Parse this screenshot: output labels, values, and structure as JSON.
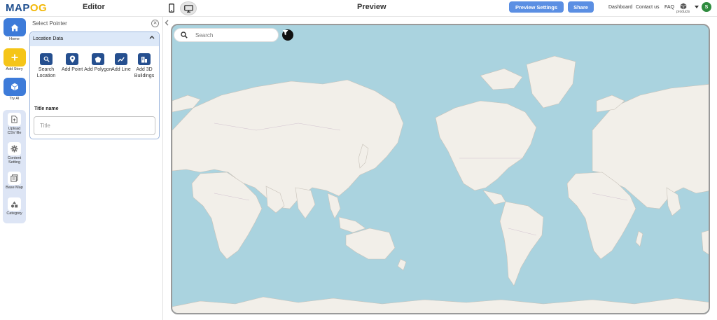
{
  "app": {
    "logo_left": "MAP",
    "logo_accent": "OG",
    "editor_title": "Editor",
    "preview_title": "Preview"
  },
  "toolbar": {
    "preview_settings_label": "Preview Settings",
    "share_label": "Share",
    "links": [
      "Dashboard",
      "Contact us",
      "FAQ"
    ],
    "products_label": "products",
    "avatar_initial": "S",
    "device_icons": [
      "mobile-icon",
      "desktop-icon"
    ]
  },
  "rail": {
    "items": [
      {
        "label": "Home",
        "icon": "home-icon"
      },
      {
        "label": "Add Story",
        "icon": "plus-icon"
      },
      {
        "label": "Try AI",
        "icon": "cube-icon"
      }
    ],
    "secondary": [
      {
        "label": "Upload CSV file",
        "icon": "file-upload-icon"
      },
      {
        "label": "Content Setting",
        "icon": "gear-icon"
      },
      {
        "label": "Base Map",
        "icon": "layers-icon"
      },
      {
        "label": "Category",
        "icon": "shapes-icon"
      }
    ]
  },
  "panel": {
    "title": "Select Pointer",
    "section_label": "Location Data",
    "tools": [
      {
        "label": "Search Location",
        "icon": "search-icon"
      },
      {
        "label": "Add Point",
        "icon": "pin-icon"
      },
      {
        "label": "Add Polygon",
        "icon": "polygon-icon"
      },
      {
        "label": "Add Line",
        "icon": "line-icon"
      },
      {
        "label": "Add 3D Buildings",
        "icon": "building-icon"
      }
    ],
    "title_name_label": "Title name",
    "title_placeholder": "Title"
  },
  "map": {
    "search_placeholder": "Search",
    "filter_icon": "filter-icon",
    "colors": {
      "water": "#aad3df",
      "land": "#f2efe9"
    }
  }
}
